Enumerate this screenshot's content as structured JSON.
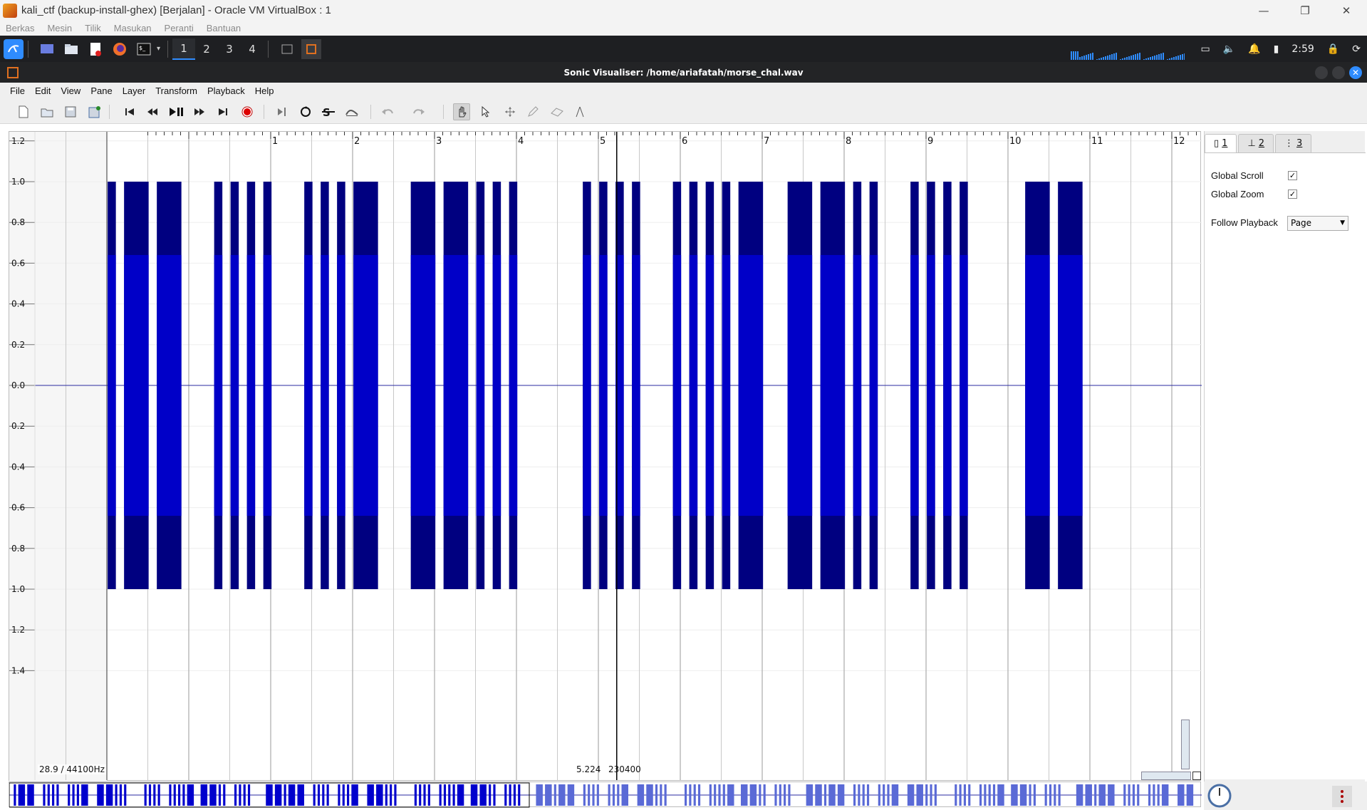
{
  "host": {
    "title": "kali_ctf (backup-install-ghex) [Berjalan] - Oracle VM VirtualBox : 1",
    "menu": [
      "Berkas",
      "Mesin",
      "Tilik",
      "Masukan",
      "Peranti",
      "Bantuan"
    ],
    "window_buttons": [
      "—",
      "❐",
      "✕"
    ]
  },
  "guest_panel": {
    "workspaces": [
      "1",
      "2",
      "3",
      "4"
    ],
    "active_workspace": "1",
    "clock": "2:59"
  },
  "app": {
    "title": "Sonic Visualiser: /home/ariafatah/morse_chal.wav",
    "menu": [
      "File",
      "Edit",
      "View",
      "Pane",
      "Layer",
      "Transform",
      "Playback",
      "Help"
    ]
  },
  "props": {
    "tabs": [
      "1",
      "2",
      "3"
    ],
    "global_scroll_label": "Global Scroll",
    "global_scroll": "✓",
    "global_zoom_label": "Global Zoom",
    "global_zoom": "✓",
    "follow_playback_label": "Follow Playback",
    "follow_playback_value": "Page"
  },
  "pane": {
    "sample_rate_text": "28.9 / 44100Hz",
    "cursor_time": "5.224",
    "cursor_frame": "230400"
  },
  "colors": {
    "waveform_dark": "#000080",
    "waveform_mid": "#0000c8",
    "overview_active": "#0000cd",
    "overview_inactive": "#5a6ad6",
    "accent": "#2f8cff"
  },
  "chart_data": {
    "type": "area",
    "xlabel": "",
    "ylabel": "",
    "x_ticks": [
      1,
      2,
      3,
      4,
      5,
      6,
      7,
      8,
      9,
      10,
      11,
      12
    ],
    "y_tick_labels": [
      "1.4",
      "1.2",
      "1.0",
      "0.8",
      "0.6",
      "0.4",
      "0.2",
      "0.0",
      "0.2",
      "0.4",
      "0.6",
      "0.8",
      "1.0",
      "1.2",
      "1.4"
    ],
    "ylim": [
      -1.5,
      1.5
    ],
    "amplitude": 1.0,
    "inner_amplitude": 0.64,
    "cursor_time": 5.224,
    "tones": [
      [
        -0.99,
        -0.89
      ],
      [
        -0.79,
        -0.49
      ],
      [
        -0.39,
        -0.09
      ],
      [
        0.31,
        0.41
      ],
      [
        0.51,
        0.61
      ],
      [
        0.71,
        0.81
      ],
      [
        0.91,
        1.01
      ],
      [
        1.41,
        1.51
      ],
      [
        1.61,
        1.71
      ],
      [
        1.81,
        1.91
      ],
      [
        2.01,
        2.31
      ],
      [
        2.71,
        3.01
      ],
      [
        3.11,
        3.41
      ],
      [
        3.51,
        3.61
      ],
      [
        3.71,
        3.81
      ],
      [
        3.91,
        4.01
      ],
      [
        4.81,
        4.91
      ],
      [
        5.01,
        5.11
      ],
      [
        5.21,
        5.31
      ],
      [
        5.41,
        5.51
      ],
      [
        5.91,
        6.01
      ],
      [
        6.11,
        6.21
      ],
      [
        6.31,
        6.41
      ],
      [
        6.51,
        6.61
      ],
      [
        6.71,
        7.01
      ],
      [
        7.31,
        7.61
      ],
      [
        7.71,
        8.01
      ],
      [
        8.11,
        8.21
      ],
      [
        8.31,
        8.41
      ],
      [
        8.81,
        8.91
      ],
      [
        9.01,
        9.11
      ],
      [
        9.21,
        9.31
      ],
      [
        9.41,
        9.51
      ],
      [
        10.21,
        10.51
      ],
      [
        10.61,
        10.91
      ]
    ]
  }
}
